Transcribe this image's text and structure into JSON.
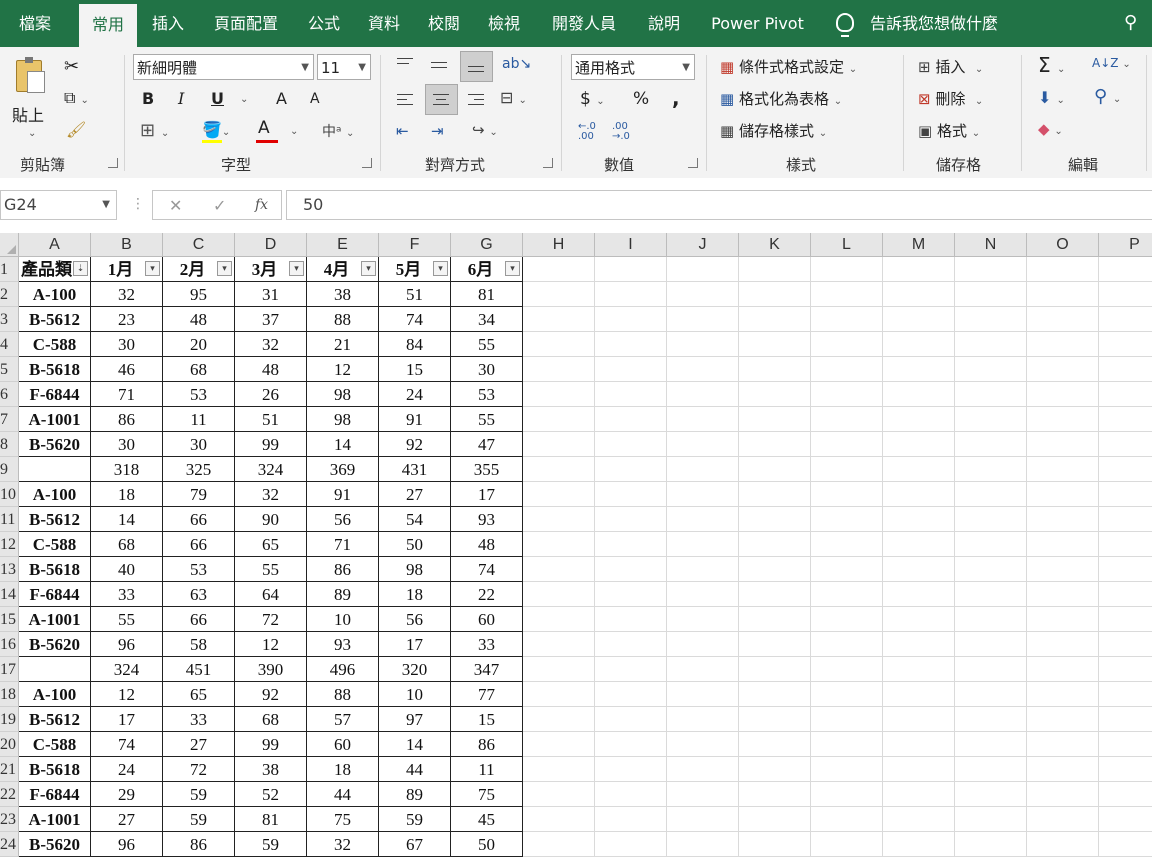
{
  "menu_tabs": [
    "檔案",
    "常用",
    "插入",
    "頁面配置",
    "公式",
    "資料",
    "校閱",
    "檢視",
    "開發人員",
    "說明",
    "Power Pivot"
  ],
  "active_tab": "常用",
  "tell_me": "告訴我您想做什麼",
  "ribbon": {
    "clipboard": {
      "paste": "貼上",
      "label": "剪貼簿"
    },
    "font": {
      "name": "新細明體",
      "size": "11",
      "bold": "B",
      "italic": "I",
      "underline": "U",
      "grow": "A",
      "shrink": "A",
      "color": "A",
      "phonetic": "中",
      "label": "字型"
    },
    "alignment": {
      "label": "對齊方式"
    },
    "number": {
      "format": "通用格式",
      "currency": "$",
      "percent": "%",
      "comma": ",",
      "label": "數值"
    },
    "styles": {
      "conditional": "條件式格式設定",
      "as_table": "格式化為表格",
      "cell_styles": "儲存格樣式",
      "label": "樣式"
    },
    "cells": {
      "insert": "插入",
      "delete": "刪除",
      "format": "格式",
      "label": "儲存格"
    },
    "editing": {
      "sum": "Σ",
      "label": "編輯"
    }
  },
  "formula_bar": {
    "name_box": "G24",
    "value": "50",
    "fx": "fx"
  },
  "columns": [
    "A",
    "B",
    "C",
    "D",
    "E",
    "F",
    "G",
    "H",
    "I",
    "J",
    "K",
    "L",
    "M",
    "N",
    "O",
    "P"
  ],
  "header_row": [
    "產品類",
    "1月",
    "2月",
    "3月",
    "4月",
    "5月",
    "6月"
  ],
  "rows": [
    [
      "A-100",
      "32",
      "95",
      "31",
      "38",
      "51",
      "81"
    ],
    [
      "B-5612",
      "23",
      "48",
      "37",
      "88",
      "74",
      "34"
    ],
    [
      "C-588",
      "30",
      "20",
      "32",
      "21",
      "84",
      "55"
    ],
    [
      "B-5618",
      "46",
      "68",
      "48",
      "12",
      "15",
      "30"
    ],
    [
      "F-6844",
      "71",
      "53",
      "26",
      "98",
      "24",
      "53"
    ],
    [
      "A-1001",
      "86",
      "11",
      "51",
      "98",
      "91",
      "55"
    ],
    [
      "B-5620",
      "30",
      "30",
      "99",
      "14",
      "92",
      "47"
    ],
    [
      "",
      "318",
      "325",
      "324",
      "369",
      "431",
      "355"
    ],
    [
      "A-100",
      "18",
      "79",
      "32",
      "91",
      "27",
      "17"
    ],
    [
      "B-5612",
      "14",
      "66",
      "90",
      "56",
      "54",
      "93"
    ],
    [
      "C-588",
      "68",
      "66",
      "65",
      "71",
      "50",
      "48"
    ],
    [
      "B-5618",
      "40",
      "53",
      "55",
      "86",
      "98",
      "74"
    ],
    [
      "F-6844",
      "33",
      "63",
      "64",
      "89",
      "18",
      "22"
    ],
    [
      "A-1001",
      "55",
      "66",
      "72",
      "10",
      "56",
      "60"
    ],
    [
      "B-5620",
      "96",
      "58",
      "12",
      "93",
      "17",
      "33"
    ],
    [
      "",
      "324",
      "451",
      "390",
      "496",
      "320",
      "347"
    ],
    [
      "A-100",
      "12",
      "65",
      "92",
      "88",
      "10",
      "77"
    ],
    [
      "B-5612",
      "17",
      "33",
      "68",
      "57",
      "97",
      "15"
    ],
    [
      "C-588",
      "74",
      "27",
      "99",
      "60",
      "14",
      "86"
    ],
    [
      "B-5618",
      "24",
      "72",
      "38",
      "18",
      "44",
      "11"
    ],
    [
      "F-6844",
      "29",
      "59",
      "52",
      "44",
      "89",
      "75"
    ],
    [
      "A-1001",
      "27",
      "59",
      "81",
      "75",
      "59",
      "45"
    ],
    [
      "B-5620",
      "96",
      "86",
      "59",
      "32",
      "67",
      "50"
    ]
  ]
}
